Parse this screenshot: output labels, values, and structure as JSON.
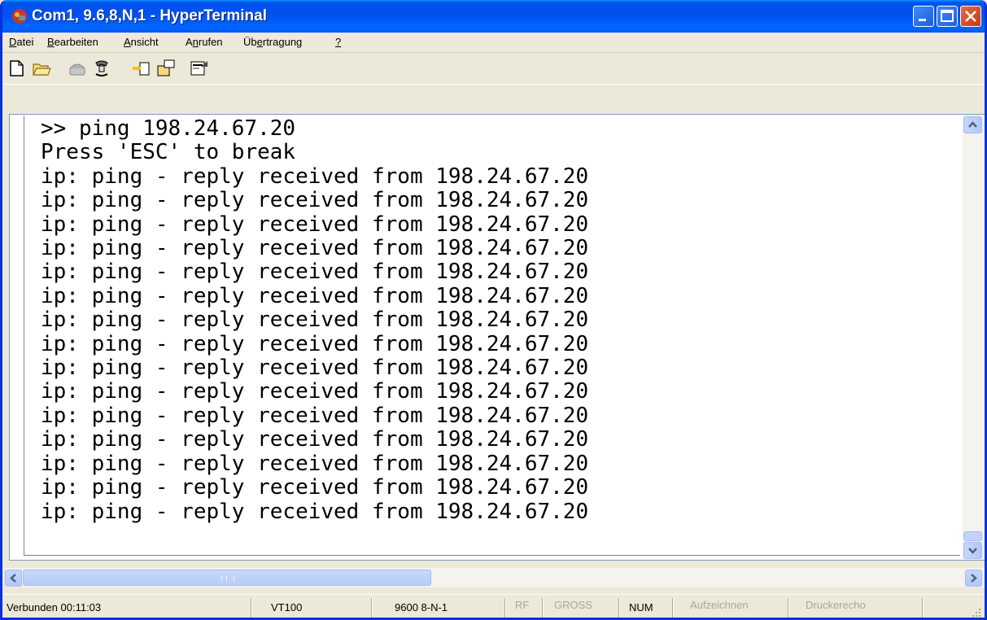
{
  "window": {
    "title": "Com1, 9.6,8,N,1 - HyperTerminal",
    "controls": [
      "minimize-icon",
      "maximize-icon",
      "close-icon"
    ]
  },
  "menu": {
    "items": [
      {
        "pre": "",
        "key": "D",
        "post": "atei"
      },
      {
        "pre": "",
        "key": "B",
        "post": "earbeiten"
      },
      {
        "pre": "",
        "key": "A",
        "post": "nsicht"
      },
      {
        "pre": "A",
        "key": "n",
        "post": "rufen"
      },
      {
        "pre": "Üb",
        "key": "e",
        "post": "rtragung"
      },
      {
        "pre": "",
        "key": "?",
        "post": ""
      }
    ]
  },
  "toolbar": {
    "icons": [
      "new-document-icon",
      "open-folder-icon",
      "call-icon",
      "disconnect-icon",
      "send-icon",
      "receive-icon",
      "properties-icon"
    ]
  },
  "terminal": {
    "lines": [
      ">> ping 198.24.67.20",
      "Press 'ESC' to break",
      "ip: ping - reply received from 198.24.67.20",
      "ip: ping - reply received from 198.24.67.20",
      "ip: ping - reply received from 198.24.67.20",
      "ip: ping - reply received from 198.24.67.20",
      "ip: ping - reply received from 198.24.67.20",
      "ip: ping - reply received from 198.24.67.20",
      "ip: ping - reply received from 198.24.67.20",
      "ip: ping - reply received from 198.24.67.20",
      "ip: ping - reply received from 198.24.67.20",
      "ip: ping - reply received from 198.24.67.20",
      "ip: ping - reply received from 198.24.67.20",
      "ip: ping - reply received from 198.24.67.20",
      "ip: ping - reply received from 198.24.67.20",
      "ip: ping - reply received from 198.24.67.20",
      "ip: ping - reply received from 198.24.67.20"
    ]
  },
  "statusbar": {
    "connection": "Verbunden 00:11:03",
    "emulation": "VT100",
    "port_settings": "9600 8-N-1",
    "rf": "RF",
    "caps": "GROSS",
    "num": "NUM",
    "capture": "Aufzeichnen",
    "print_echo": "Druckerecho"
  },
  "colors": {
    "titlebar": "#0053ee",
    "chrome": "#ece9d8",
    "terminal_bg": "#ffffff",
    "disabled_text": "#a9a89f"
  }
}
